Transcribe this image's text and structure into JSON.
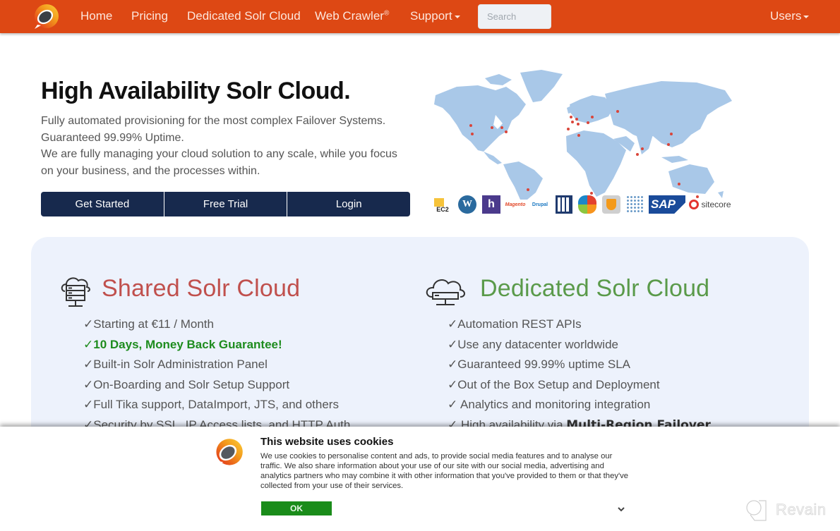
{
  "nav": {
    "logo_icon": "site-logo-icon",
    "items": [
      {
        "label": "Home"
      },
      {
        "label": "Pricing"
      },
      {
        "label": "Dedicated Solr Cloud"
      },
      {
        "label": "Web Crawler",
        "sup": "®"
      },
      {
        "label": "Support",
        "dropdown": true
      }
    ],
    "search_placeholder": "Search",
    "users_label": "Users",
    "color": "#dd4814"
  },
  "hero": {
    "title": "High Availability Solr Cloud.",
    "lines": [
      "Fully automated provisioning for the most complex Failover Systems.",
      "Guaranteed 99.99% Uptime.",
      "We are fully managing your cloud solution to any scale, while you focus",
      "on your business, and the processes within."
    ],
    "buttons": [
      "Get Started",
      "Free Trial",
      "Login"
    ],
    "button_color": "#17294d"
  },
  "integrations": [
    "EC2",
    "WordPress",
    "Heroku",
    "Magento",
    "Drupal",
    "Umbraco",
    "Joomla",
    "TYPO3",
    "Hybris",
    "SAP",
    "sitecore"
  ],
  "shared": {
    "title": "Shared Solr Cloud",
    "title_color": "#c0504d",
    "features": [
      {
        "text": "✓Starting at €11 / Month"
      },
      {
        "text": "✓10 Days, Money Back Guarantee!",
        "highlight": true
      },
      {
        "text": "✓Built-in Solr Administration Panel"
      },
      {
        "text": "✓On-Boarding and Solr Setup Support"
      },
      {
        "text": "✓Full Tika support, DataImport, JTS, and others"
      },
      {
        "text": "✓Security by SSL, IP Access lists, and HTTP Auth"
      }
    ]
  },
  "dedicated": {
    "title": "Dedicated Solr Cloud",
    "title_color": "#5a9a4a",
    "features": [
      {
        "text": "✓Automation REST APIs"
      },
      {
        "text": "✓Use any datacenter worldwide"
      },
      {
        "text": "✓Guaranteed 99.99% uptime SLA"
      },
      {
        "text": "✓Out of the Box Setup and Deployment"
      },
      {
        "text": "✓ Analytics and monitoring integration"
      },
      {
        "text": "✓ High availability via ",
        "bold": "Multi-Region Failover"
      }
    ]
  },
  "cookie": {
    "title": "This website uses cookies",
    "text": "We use cookies to personalise content and ads, to provide social media features and to analyse our traffic. We also share information about your use of our site with our social media, advertising and analytics partners who may combine it with other information that you've provided to them or that they've collected from your use of their services.",
    "ok_label": "OK",
    "ok_color": "#1a8c1a"
  },
  "watermark": "Revain"
}
